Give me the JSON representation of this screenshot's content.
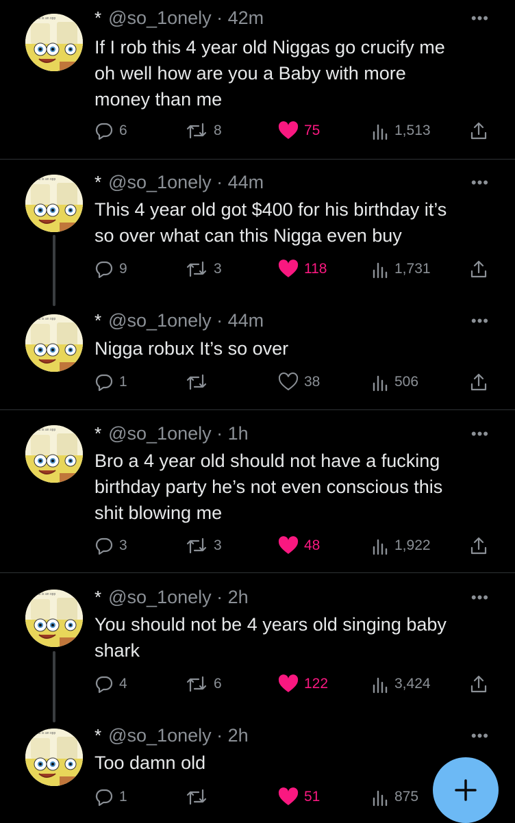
{
  "tweets": [
    {
      "asterisk": "*",
      "handle": "@so_1onely",
      "time": "42m",
      "lines": [
        "If I rob this 4 year old  Niggas go crucify me",
        "oh well how are you a Baby with more",
        "money than me"
      ],
      "replies": "6",
      "retweets": "8",
      "likes": "75",
      "views": "1,513",
      "liked": true
    },
    {
      "asterisk": "*",
      "handle": "@so_1onely",
      "time": "44m",
      "lines": [
        "This 4 year old got $400 for his birthday it’s",
        "so over what can this Nigga even buy"
      ],
      "replies": "9",
      "retweets": "3",
      "likes": "118",
      "views": "1,731",
      "liked": true
    },
    {
      "asterisk": "*",
      "handle": "@so_1onely",
      "time": "44m",
      "lines": [
        "Nigga robux It’s so over"
      ],
      "replies": "1",
      "retweets": "",
      "likes": "38",
      "views": "506",
      "liked": false
    },
    {
      "asterisk": "*",
      "handle": "@so_1onely",
      "time": "1h",
      "lines": [
        "Bro a 4 year old should not have a fucking",
        "birthday party he’s not even conscious this",
        "shit blowing me"
      ],
      "replies": "3",
      "retweets": "3",
      "likes": "48",
      "views": "1,922",
      "liked": true
    },
    {
      "asterisk": "*",
      "handle": "@so_1onely",
      "time": "2h",
      "lines": [
        "You should not be 4 years old singing baby",
        "shark"
      ],
      "replies": "4",
      "retweets": "6",
      "likes": "122",
      "views": "3,424",
      "liked": true
    },
    {
      "asterisk": "*",
      "handle": "@so_1onely",
      "time": "2h",
      "lines": [
        "Too damn old"
      ],
      "replies": "1",
      "retweets": "",
      "likes": "51",
      "views": "875",
      "liked": true
    }
  ],
  "avatar_caption": "what is an opp",
  "more_glyph": "•••",
  "fab_label": "+",
  "colors": {
    "background": "#000000",
    "text": "#e7e9ea",
    "muted": "#8b9096",
    "like": "#f91880",
    "fab": "#6cb9f5"
  },
  "icons": {
    "reply": "reply-icon",
    "retweet": "retweet-icon",
    "like": "heart-icon",
    "views": "views-icon",
    "share": "share-icon"
  }
}
